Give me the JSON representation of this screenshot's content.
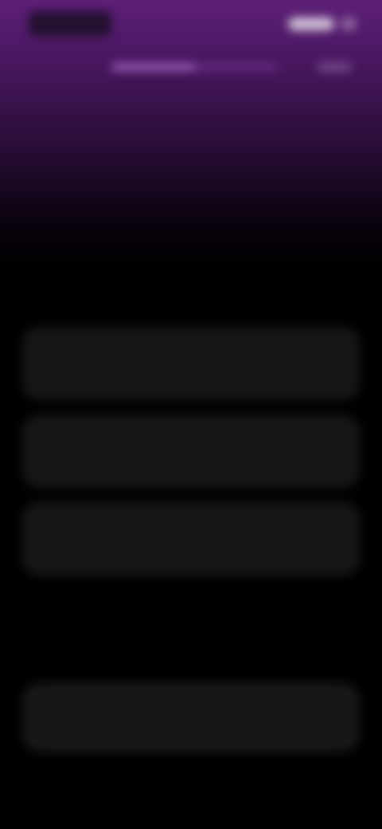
{
  "header": {
    "logo_icon": "brand-logo-icon",
    "top_action_label": "",
    "progress_fraction": 0.5,
    "step_counter": ""
  },
  "question": {
    "title": "",
    "subtitle": ""
  },
  "options": [
    {
      "label": ""
    },
    {
      "label": ""
    },
    {
      "label": ""
    }
  ],
  "continue_button": {
    "label": ""
  },
  "colors": {
    "accent_top": "#5e1f78",
    "background": "#000000",
    "option_bg": "#161616",
    "progress_fill": "#be78dc"
  }
}
